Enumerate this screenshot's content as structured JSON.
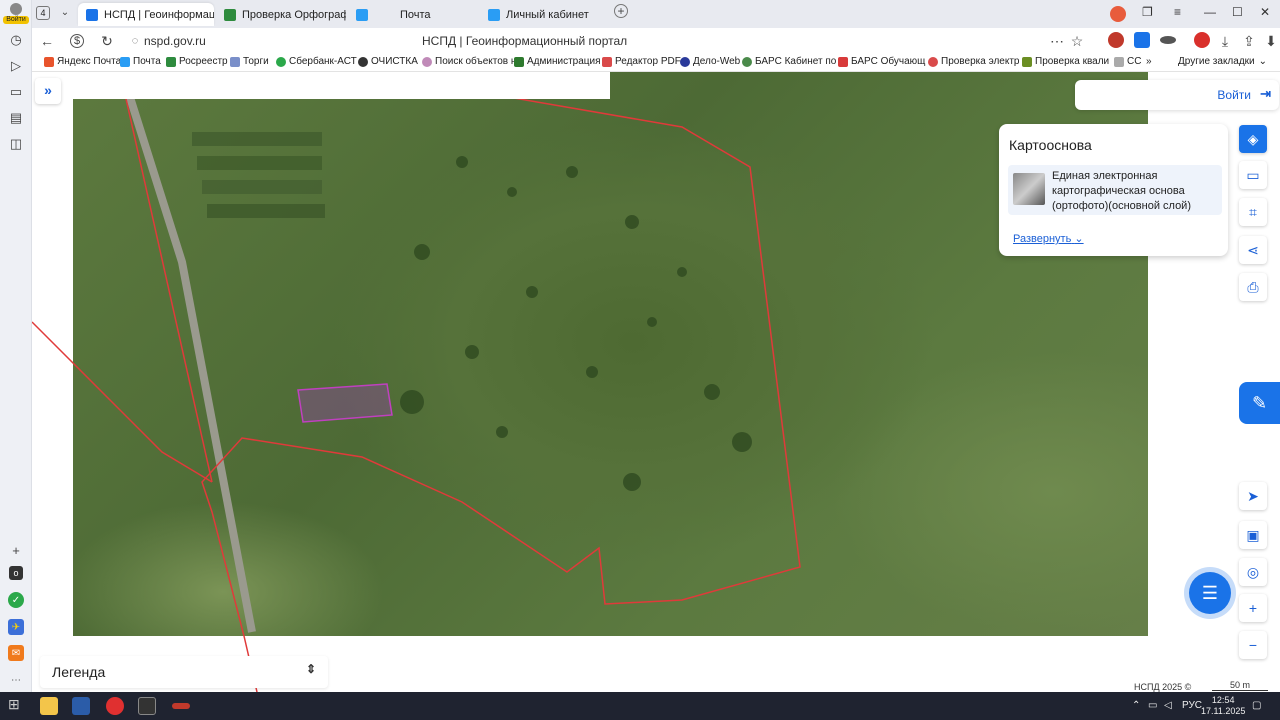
{
  "browser": {
    "tab_count": "4",
    "profile_label": "Войти",
    "tabs": [
      {
        "label": "НСПД | Геоинформац",
        "color": "#1a73e8"
      },
      {
        "label": "Проверка Орфографии и",
        "color": "#2e8b3e"
      },
      {
        "label": "Почта",
        "color": "#2a9df4"
      },
      {
        "label": "Личный кабинет",
        "color": "#2a9df4"
      }
    ],
    "url": "nspd.gov.ru",
    "page_title": "НСПД | Геоинформационный портал",
    "bookmarks": [
      "Яндекс Почта",
      "Почта",
      "Росреестр",
      "Торги",
      "Сбербанк-АСТ",
      "ОЧИСТКА",
      "Поиск объектов н",
      "Администрация",
      "Редактор PDF",
      "Дело-Web",
      "БАРС Кабинет по",
      "БАРС Обучающ",
      "Проверка электр",
      "Проверка квали",
      "СС"
    ],
    "more_bookmarks": "»",
    "other_bookmarks": "Другие закладки"
  },
  "map": {
    "login": "Войти",
    "basemap_title": "Картооснова",
    "layer_name": "Единая электронная картографическая основа (ортофото)(основной слой)",
    "expand_label": "Развернуть",
    "legend_label": "Легенда",
    "footer": "НСПД 2025 ©",
    "scale": "50 m"
  },
  "taskbar": {
    "lang": "РУС",
    "time": "12:54",
    "date": "17.11.2025"
  },
  "colors": {
    "accent": "#1a73e8",
    "boundary": "#e03a3a",
    "parcel": "#c040c0"
  }
}
